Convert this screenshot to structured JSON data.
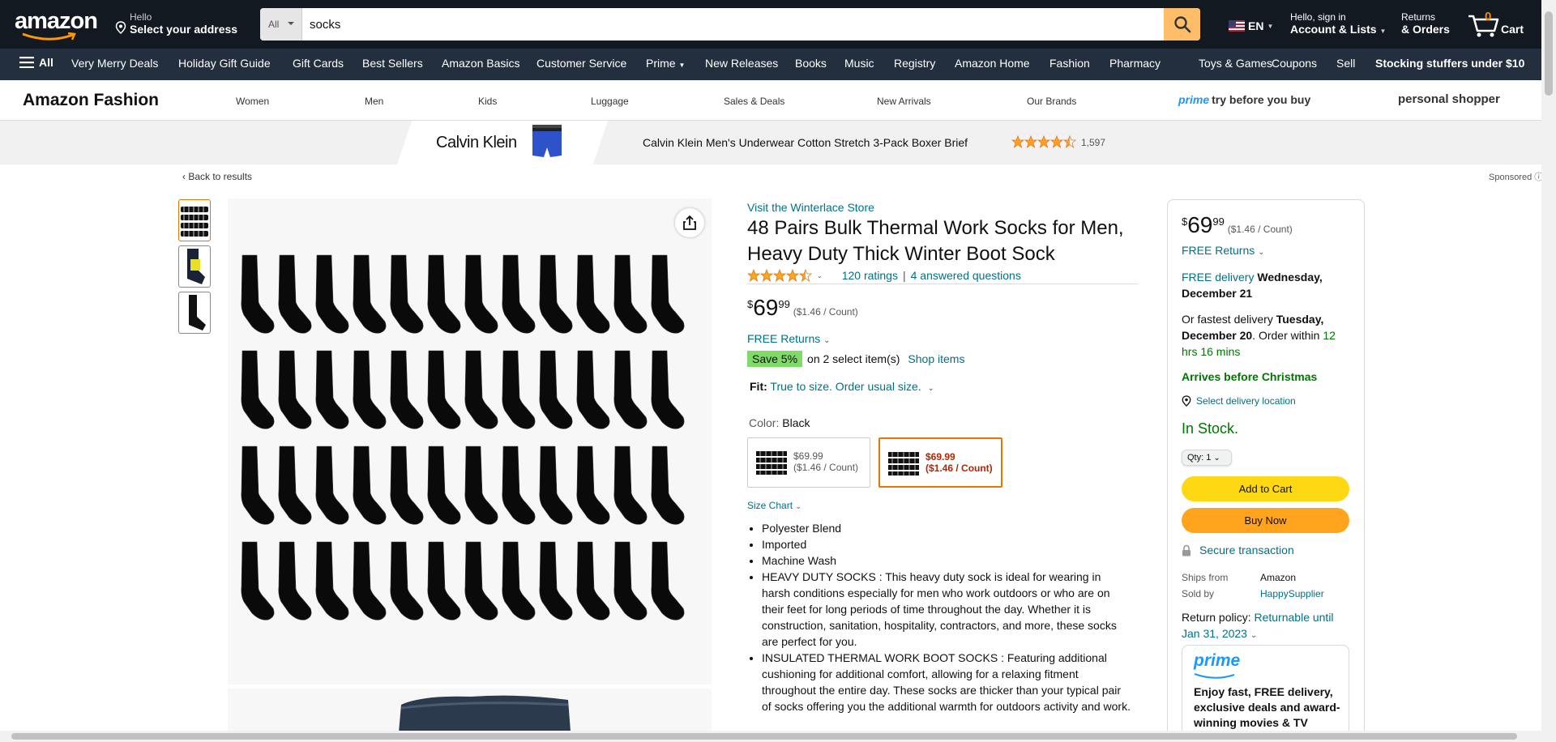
{
  "header": {
    "logo": "amazon",
    "address_line1": "Hello",
    "address_line2": "Select your address",
    "search_category": "All",
    "search_value": "socks",
    "language": "EN",
    "account_line1": "Hello, sign in",
    "account_line2": "Account & Lists",
    "orders_line1": "Returns",
    "orders_line2": "& Orders",
    "cart_count": "0",
    "cart_label": "Cart"
  },
  "main_nav": {
    "all_label": "All",
    "items": [
      "Very Merry Deals",
      "Holiday Gift Guide",
      "Gift Cards",
      "Best Sellers",
      "Amazon Basics",
      "Customer Service",
      "Prime",
      "New Releases",
      "Books",
      "Music",
      "Registry",
      "Amazon Home",
      "Fashion",
      "Pharmacy",
      "Toys & Games",
      "Coupons",
      "Sell"
    ],
    "promo": "Stocking stuffers under $10"
  },
  "fashion_nav": {
    "title": "Amazon Fashion",
    "links": [
      "Women",
      "Men",
      "Kids",
      "Luggage",
      "Sales & Deals",
      "New Arrivals",
      "Our Brands"
    ],
    "prime_word": "prime",
    "prime_tail": "try before you buy",
    "personal_shopper": "personal shopper"
  },
  "banner": {
    "brand": "Calvin Klein",
    "title": "Calvin Klein Men's Underwear Cotton Stretch 3-Pack Boxer Brief",
    "rating": 4.5,
    "rating_count": "1,597"
  },
  "breadcrumb": {
    "back": "‹ Back to results",
    "sponsored": "Sponsored"
  },
  "product": {
    "store_link": "Visit the Winterlace Store",
    "title": "48 Pairs Bulk Thermal Work Socks for Men, Heavy Duty Thick Winter Boot Sock",
    "rating": 4.5,
    "ratings_count": "120 ratings",
    "separator": "|",
    "answered": "4 answered questions",
    "price_symbol": "$",
    "price_whole": "69",
    "price_fraction": "99",
    "price_unit": "($1.46 / Count)",
    "free_returns": "FREE Returns",
    "save_badge": "Save 5%",
    "save_text": "on 2 select item(s)",
    "shop_items": "Shop items",
    "fit_label": "Fit:",
    "fit_value": "True to size. Order usual size.",
    "color_label": "Color:",
    "color_value": "Black",
    "swatches": [
      {
        "price": "$69.99",
        "unit": "($1.46 / Count)",
        "selected": false
      },
      {
        "price": "$69.99",
        "unit": "($1.46 / Count)",
        "selected": true
      }
    ],
    "size_chart": "Size Chart",
    "bullets": [
      "Polyester Blend",
      "Imported",
      "Machine Wash",
      "HEAVY DUTY SOCKS : This heavy duty sock is ideal for wearing in harsh conditions especially for men who work outdoors or who are on their feet for long periods of time throughout the day. Whether it is construction, sanitation, hospitality, contractors, and more, these socks are perfect for you.",
      "INSULATED THERMAL WORK BOOT SOCKS : Featuring additional cushioning for additional comfort, allowing for a relaxing fitment throughout the entire day. These socks are thicker than your typical pair of socks offering you the additional warmth for outdoors activity and work."
    ]
  },
  "buybox": {
    "price_symbol": "$",
    "price_whole": "69",
    "price_fraction": "99",
    "price_unit": "($1.46 / Count)",
    "free_returns": "FREE Returns",
    "delivery_link": "FREE delivery",
    "delivery_date": "Wednesday, December 21",
    "fastest_prefix": "Or fastest delivery",
    "fastest_date": "Tuesday, December 20",
    "order_within_prefix": ". Order within",
    "order_within_time": "12 hrs 16 mins",
    "christmas": "Arrives before Christmas",
    "location": "Select delivery location",
    "stock": "In Stock.",
    "qty_label": "Qty: 1",
    "add_to_cart": "Add to Cart",
    "buy_now": "Buy Now",
    "secure": "Secure transaction",
    "ships_from_label": "Ships from",
    "ships_from_value": "Amazon",
    "sold_by_label": "Sold by",
    "sold_by_value": "HappySupplier",
    "return_label": "Return policy:",
    "return_value": "Returnable until Jan 31, 2023",
    "prime_logo": "prime",
    "prime_text": "Enjoy fast, FREE delivery, exclusive deals and award-winning movies & TV"
  },
  "colors": {
    "nav_dark": "#131921",
    "nav_secondary": "#232f3e",
    "link": "#007185",
    "in_stock": "#007600",
    "add_to_cart": "#ffd814",
    "buy_now": "#ffa41c",
    "save_badge": "#7fda69",
    "star": "#ffa41c"
  }
}
